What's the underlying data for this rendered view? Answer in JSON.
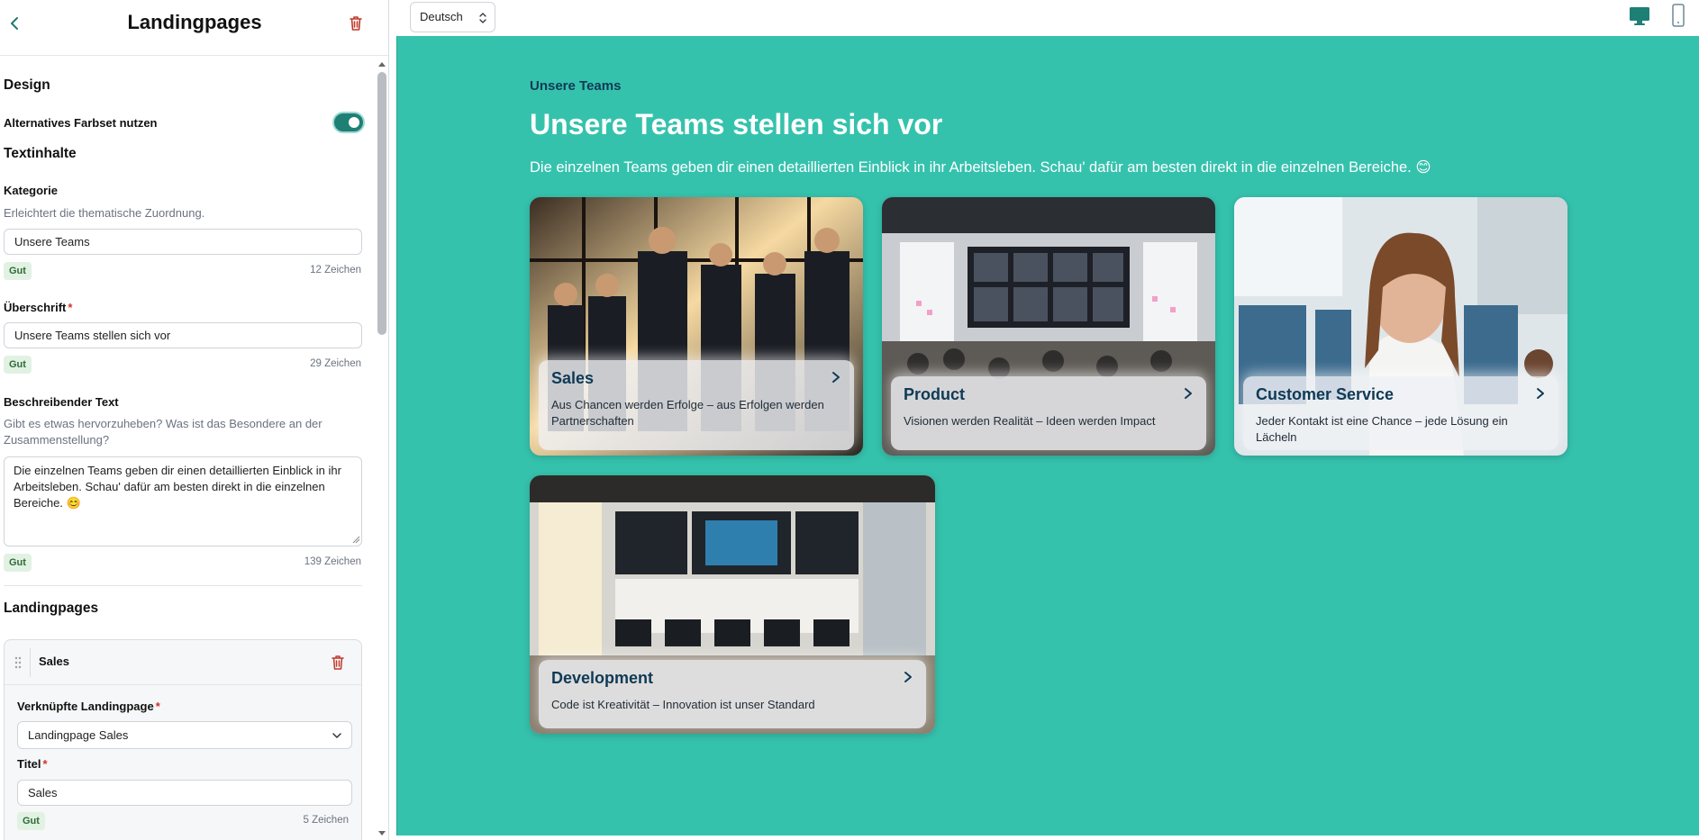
{
  "editor": {
    "title": "Landingpages",
    "design_heading": "Design",
    "alt_color_label": "Alternatives Farbset nutzen",
    "alt_color_on": true,
    "text_heading": "Textinhalte",
    "category": {
      "label": "Kategorie",
      "help": "Erleichtert die thematische Zuordnung.",
      "value": "Unsere Teams",
      "badge": "Gut",
      "count": "12 Zeichen"
    },
    "headline": {
      "label": "Überschrift",
      "required": "*",
      "value": "Unsere Teams stellen sich vor",
      "badge": "Gut",
      "count": "29 Zeichen"
    },
    "description": {
      "label": "Beschreibender Text",
      "help": "Gibt es etwas hervorzuheben? Was ist das Besondere an der Zusammenstellung?",
      "value": "Die einzelnen Teams geben dir einen detaillierten Einblick in ihr Arbeitsleben. Schau' dafür am besten direkt in die einzelnen Bereiche. 😊",
      "badge": "Gut",
      "count": "139 Zeichen"
    },
    "landingpages_heading": "Landingpages",
    "item": {
      "title": "Sales",
      "linked_label": "Verknüpfte Landingpage",
      "linked_value": "Landingpage Sales",
      "title_label": "Titel",
      "required": "*",
      "title_value": "Sales",
      "badge": "Gut",
      "count": "5 Zeichen"
    }
  },
  "preview": {
    "language": "Deutsch",
    "eyebrow": "Unsere Teams",
    "title": "Unsere Teams stellen sich vor",
    "description": "Die einzelnen Teams geben dir einen detaillierten Einblick in ihr Arbeitsleben. Schau' dafür am besten direkt in die einzelnen Bereiche. 😊",
    "tiles": [
      {
        "name": "Sales",
        "subtitle": "Aus Chancen werden Erfolge – aus Erfolgen werden Partnerschaften"
      },
      {
        "name": "Product",
        "subtitle": "Visionen werden Realität – Ideen werden Impact"
      },
      {
        "name": "Customer Service",
        "subtitle": "Jeder Kontakt ist eine Chance – jede Lösung ein Lächeln"
      },
      {
        "name": "Development",
        "subtitle": "Code ist Kreativität – Innovation ist unser Standard"
      }
    ]
  },
  "colors": {
    "accent": "#1e7f75",
    "preview_bg": "#35c2ad",
    "heading_dark": "#0f3a55",
    "danger": "#c0392b",
    "good_badge_bg": "#e1f2e3"
  }
}
